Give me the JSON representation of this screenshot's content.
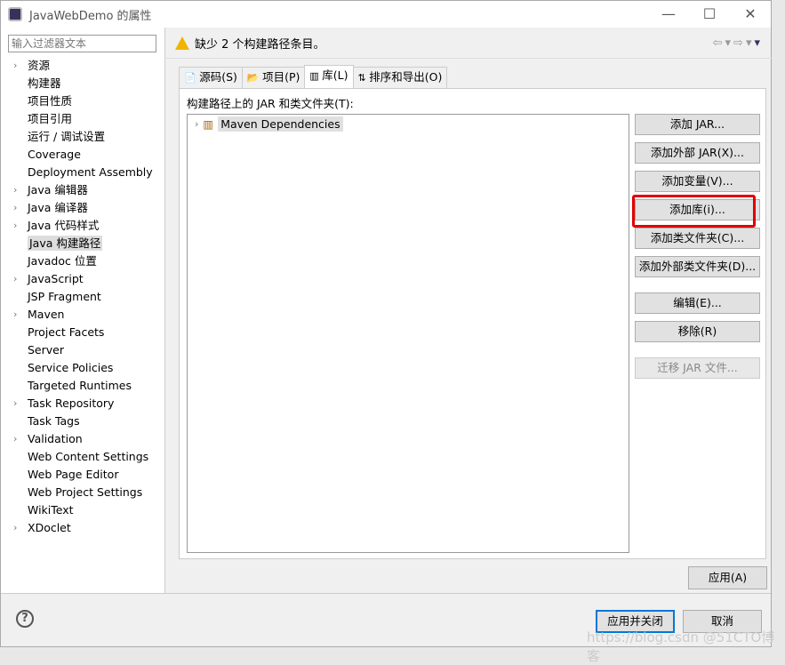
{
  "window": {
    "title": "JavaWebDemo 的属性"
  },
  "filter": {
    "placeholder": "输入过滤器文本"
  },
  "tree": [
    {
      "label": "资源",
      "expandable": true
    },
    {
      "label": "构建器"
    },
    {
      "label": "项目性质"
    },
    {
      "label": "项目引用"
    },
    {
      "label": "运行 / 调试设置"
    },
    {
      "label": "Coverage"
    },
    {
      "label": "Deployment Assembly"
    },
    {
      "label": "Java 编辑器",
      "expandable": true
    },
    {
      "label": "Java 编译器",
      "expandable": true
    },
    {
      "label": "Java 代码样式",
      "expandable": true
    },
    {
      "label": "Java 构建路径",
      "selected": true
    },
    {
      "label": "Javadoc 位置"
    },
    {
      "label": "JavaScript",
      "expandable": true
    },
    {
      "label": "JSP Fragment"
    },
    {
      "label": "Maven",
      "expandable": true
    },
    {
      "label": "Project Facets"
    },
    {
      "label": "Server"
    },
    {
      "label": "Service Policies"
    },
    {
      "label": "Targeted Runtimes"
    },
    {
      "label": "Task Repository",
      "expandable": true
    },
    {
      "label": "Task Tags"
    },
    {
      "label": "Validation",
      "expandable": true
    },
    {
      "label": "Web Content Settings"
    },
    {
      "label": "Web Page Editor"
    },
    {
      "label": "Web Project Settings"
    },
    {
      "label": "WikiText"
    },
    {
      "label": "XDoclet",
      "expandable": true
    }
  ],
  "message": "缺少 2 个构建路径条目。",
  "tabs": [
    {
      "label": "源码(S)"
    },
    {
      "label": "项目(P)"
    },
    {
      "label": "库(L)",
      "active": true
    },
    {
      "label": "排序和导出(O)"
    }
  ],
  "panel": {
    "label": "构建路径上的 JAR 和类文件夹(T):",
    "items": [
      "Maven Dependencies"
    ]
  },
  "buttons": [
    "添加 JAR...",
    "添加外部 JAR(X)...",
    "添加变量(V)...",
    "添加库(i)...",
    "添加类文件夹(C)...",
    "添加外部类文件夹(D)...",
    "编辑(E)...",
    "移除(R)",
    "迁移 JAR 文件..."
  ],
  "highlight_color": "#e00000",
  "apply": "应用(A)",
  "apply_close": "应用并关闭",
  "cancel": "取消",
  "watermark": "https://blog.csdn @51CTO博客"
}
